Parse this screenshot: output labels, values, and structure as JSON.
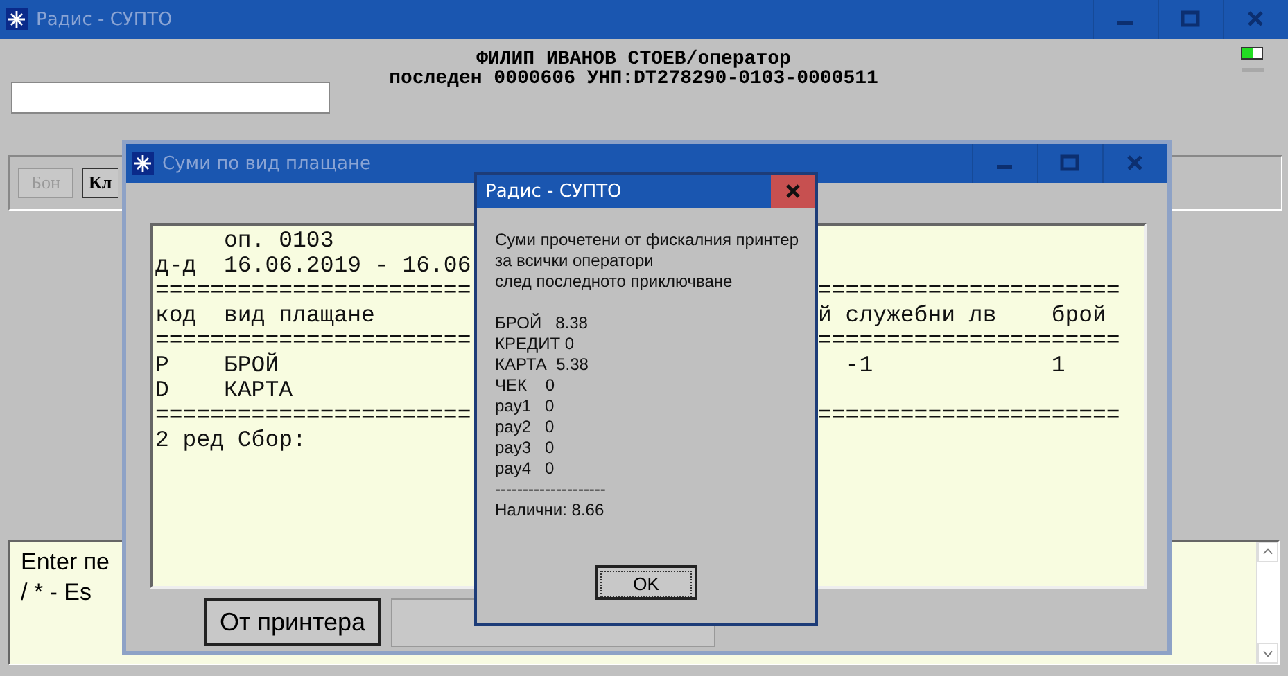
{
  "main_window": {
    "title": "Радис - СУПТО",
    "operator": "ФИЛИП ИВАНОВ СТОЕВ/оператор",
    "receipt_info": "последен 0000606 УНП:DT278290-0103-0000511",
    "toolbar": [
      {
        "label": "Бон",
        "disabled": true
      },
      {
        "label": "Кл",
        "disabled": false
      }
    ],
    "console": {
      "lines": [
        "Enter пе",
        "/ * - Es"
      ]
    }
  },
  "payments_window": {
    "title": "Суми по вид плащане",
    "report": [
      {
        "left": "     оп. 0103"
      },
      {
        "left": "д-д  16.06.2019 - 16.06"
      },
      {
        "left": "=======================",
        "right": "======================"
      },
      {
        "left": "код  вид плащане",
        "right": "й служебни лв    брой"
      },
      {
        "left": "=======================",
        "right": "======================"
      },
      {
        "left": "P    БРОЙ",
        "right": "  -1             1"
      },
      {
        "left": "D    КАРТА"
      },
      {
        "left": "=======================",
        "right": "======================"
      },
      {
        "left": "2 ред Сбор:"
      }
    ],
    "buttons": [
      "От принтера"
    ]
  },
  "dialog": {
    "title": "Радис - СУПТО",
    "message": [
      "Суми прочетени от фискалния принтер",
      "за всички оператори",
      "след последното приключване"
    ],
    "amounts": [
      "БРОЙ   8.38",
      "КРЕДИТ 0",
      "КАРТА  5.38",
      "ЧЕК    0",
      "pay1   0",
      "pay2   0",
      "pay3   0",
      "pay4   0"
    ],
    "separator": "--------------------",
    "total": "Налични: 8.66",
    "ok": "OK"
  }
}
